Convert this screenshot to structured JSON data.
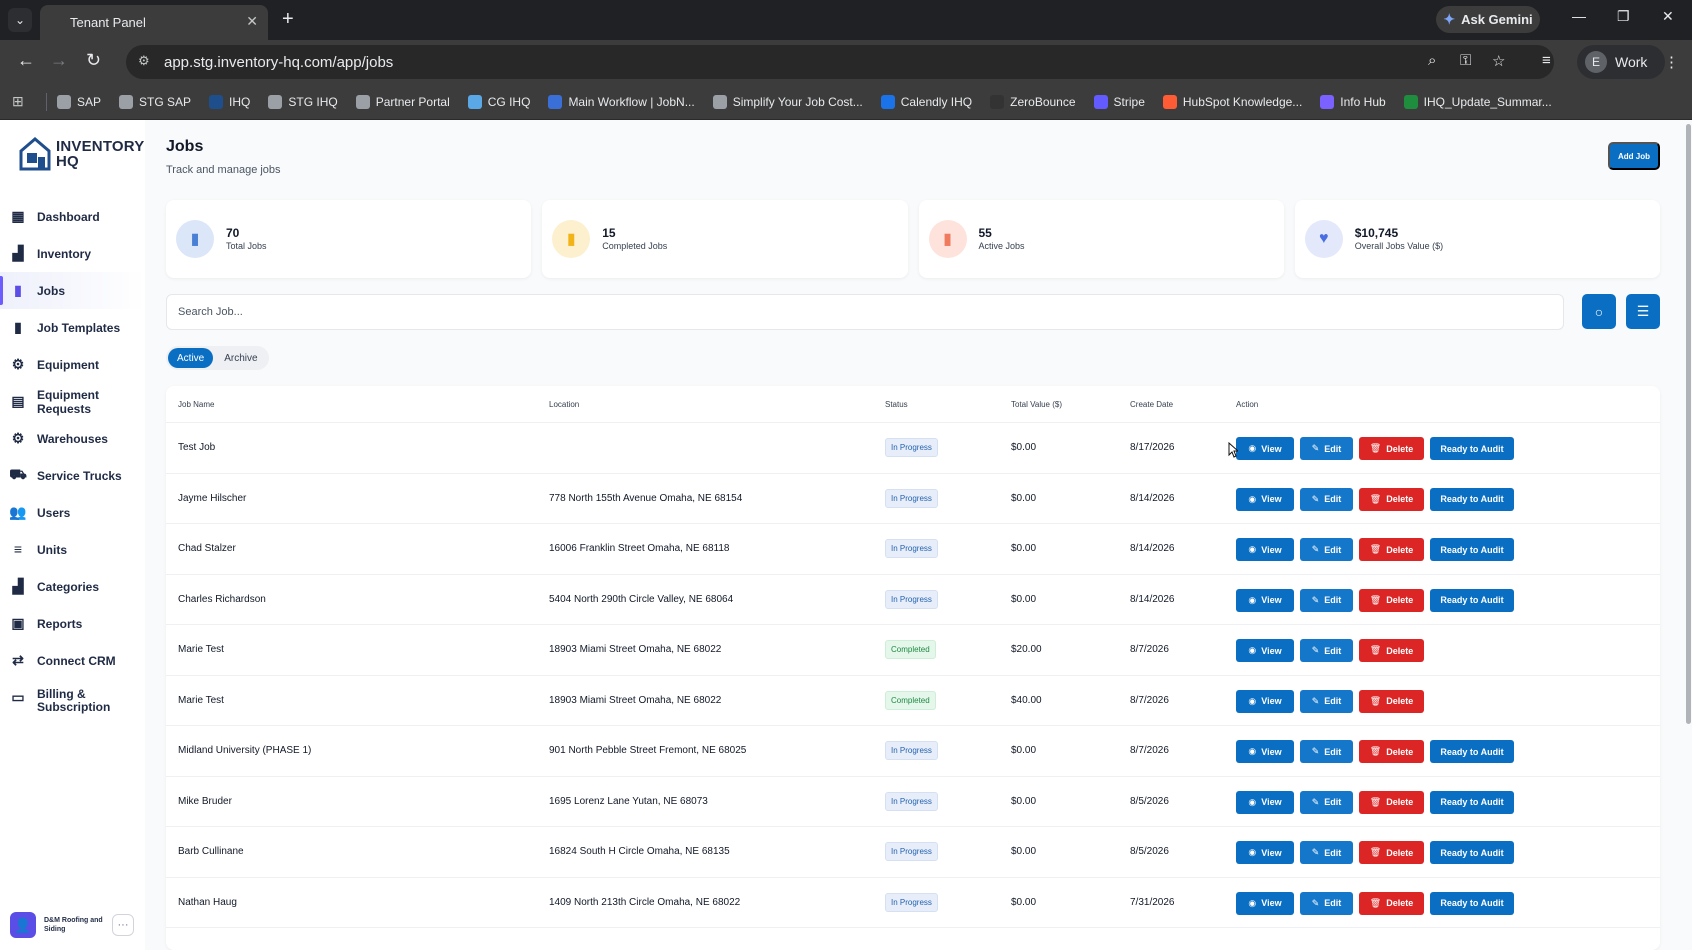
{
  "browser": {
    "tab_title": "Tenant Panel",
    "url": "app.stg.inventory-hq.com/app/jobs",
    "gemini_label": "Ask Gemini",
    "profile_initial": "E",
    "profile_name": "Work",
    "bookmarks": [
      {
        "label": "SAP",
        "color": "#9aa0a6"
      },
      {
        "label": "STG SAP",
        "color": "#9aa0a6"
      },
      {
        "label": "IHQ",
        "color": "#1f4e8c"
      },
      {
        "label": "STG IHQ",
        "color": "#9aa0a6"
      },
      {
        "label": "Partner Portal",
        "color": "#9aa0a6"
      },
      {
        "label": "CG IHQ",
        "color": "#5aa9e6"
      },
      {
        "label": "Main Workflow | JobN...",
        "color": "#3b6fd8"
      },
      {
        "label": "Simplify Your Job Cost...",
        "color": "#9aa0a6"
      },
      {
        "label": "Calendly IHQ",
        "color": "#1a73e8"
      },
      {
        "label": "ZeroBounce",
        "color": "#333333"
      },
      {
        "label": "Stripe",
        "color": "#635bff"
      },
      {
        "label": "HubSpot Knowledge...",
        "color": "#ff5c35"
      },
      {
        "label": "Info Hub",
        "color": "#7b61ff"
      },
      {
        "label": "IHQ_Update_Summar...",
        "color": "#1e8e3e"
      }
    ]
  },
  "brand": {
    "line1": "INVENTORY",
    "line2": "HQ"
  },
  "sidebar": {
    "items": [
      {
        "label": "Dashboard",
        "icon": "dashboard-icon",
        "glyph": "▦"
      },
      {
        "label": "Inventory",
        "icon": "inventory-icon",
        "glyph": "▟"
      },
      {
        "label": "Jobs",
        "icon": "jobs-icon",
        "glyph": "▮"
      },
      {
        "label": "Job Templates",
        "icon": "job-templates-icon",
        "glyph": "▮"
      },
      {
        "label": "Equipment",
        "icon": "equipment-icon",
        "glyph": "⚙"
      },
      {
        "label": "Equipment Requests",
        "icon": "equipment-requests-icon",
        "glyph": "▤"
      },
      {
        "label": "Warehouses",
        "icon": "warehouses-icon",
        "glyph": "⚙"
      },
      {
        "label": "Service Trucks",
        "icon": "truck-icon",
        "glyph": "⛟"
      },
      {
        "label": "Users",
        "icon": "users-icon",
        "glyph": "👥"
      },
      {
        "label": "Units",
        "icon": "units-icon",
        "glyph": "≡"
      },
      {
        "label": "Categories",
        "icon": "categories-icon",
        "glyph": "▟"
      },
      {
        "label": "Reports",
        "icon": "reports-icon",
        "glyph": "▣"
      },
      {
        "label": "Connect CRM",
        "icon": "crm-icon",
        "glyph": "⇄"
      },
      {
        "label": "Billing & Subscription",
        "icon": "billing-icon",
        "glyph": "▭"
      }
    ],
    "company": "D&M Roofing and Siding"
  },
  "header": {
    "title": "Jobs",
    "subtitle": "Track and manage jobs",
    "add_button": "Add Job"
  },
  "stats": [
    {
      "value": "70",
      "label": "Total Jobs",
      "color": "#dbe6f8",
      "icon_color": "#4a7fd6"
    },
    {
      "value": "15",
      "label": "Completed Jobs",
      "color": "#fdf0cf",
      "icon_color": "#f2b318"
    },
    {
      "value": "55",
      "label": "Active Jobs",
      "color": "#fde3dc",
      "icon_color": "#ef7a5e"
    },
    {
      "value": "$10,745",
      "label": "Overall Jobs Value ($)",
      "color": "#e3e8fb",
      "icon_color": "#4a6ee0"
    }
  ],
  "search": {
    "placeholder": "Search Job..."
  },
  "filter_tabs": {
    "active": "Active",
    "archive": "Archive"
  },
  "table": {
    "columns": [
      "Job Name",
      "Location",
      "Status",
      "Total Value ($)",
      "Create Date",
      "Action"
    ],
    "rows": [
      {
        "name": "Test Job",
        "location": "",
        "status": "In Progress",
        "value": "$0.00",
        "date": "8/17/2026",
        "audit": true
      },
      {
        "name": "Jayme Hilscher",
        "location": "778 North 155th Avenue Omaha, NE 68154",
        "status": "In Progress",
        "value": "$0.00",
        "date": "8/14/2026",
        "audit": true
      },
      {
        "name": "Chad Stalzer",
        "location": "16006 Franklin Street Omaha, NE 68118",
        "status": "In Progress",
        "value": "$0.00",
        "date": "8/14/2026",
        "audit": true
      },
      {
        "name": "Charles Richardson",
        "location": "5404 North 290th Circle Valley, NE 68064",
        "status": "In Progress",
        "value": "$0.00",
        "date": "8/14/2026",
        "audit": true
      },
      {
        "name": "Marie Test",
        "location": "18903 Miami Street Omaha, NE 68022",
        "status": "Completed",
        "value": "$20.00",
        "date": "8/7/2026",
        "audit": false
      },
      {
        "name": "Marie Test",
        "location": "18903 Miami Street Omaha, NE 68022",
        "status": "Completed",
        "value": "$40.00",
        "date": "8/7/2026",
        "audit": false
      },
      {
        "name": "Midland University (PHASE 1)",
        "location": "901 North Pebble Street Fremont, NE 68025",
        "status": "In Progress",
        "value": "$0.00",
        "date": "8/7/2026",
        "audit": true
      },
      {
        "name": "Mike Bruder",
        "location": "1695 Lorenz Lane Yutan, NE 68073",
        "status": "In Progress",
        "value": "$0.00",
        "date": "8/5/2026",
        "audit": true
      },
      {
        "name": "Barb Cullinane",
        "location": "16824 South H Circle Omaha, NE 68135",
        "status": "In Progress",
        "value": "$0.00",
        "date": "8/5/2026",
        "audit": true
      },
      {
        "name": "Nathan Haug",
        "location": "1409 North 213th Circle Omaha, NE 68022",
        "status": "In Progress",
        "value": "$0.00",
        "date": "7/31/2026",
        "audit": true
      }
    ],
    "actions": {
      "view": "View",
      "edit": "Edit",
      "delete": "Delete",
      "audit": "Ready to Audit"
    }
  }
}
